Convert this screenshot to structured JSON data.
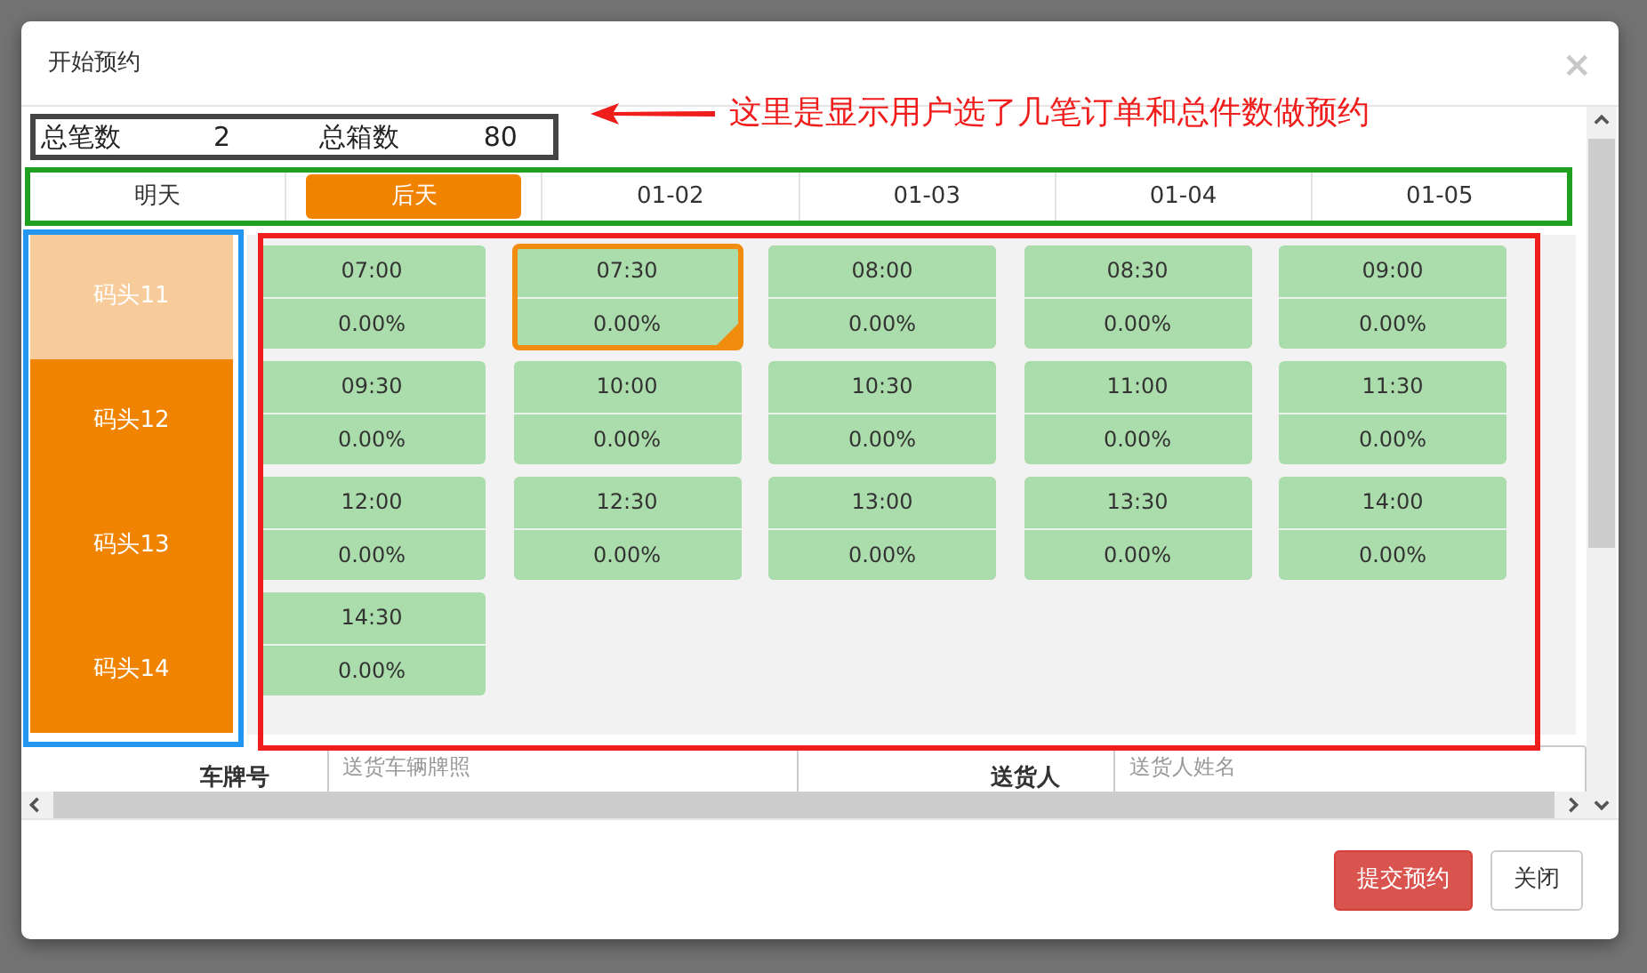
{
  "dialog": {
    "title": "开始预约",
    "close": "×"
  },
  "summary": [
    {
      "label": "总笔数",
      "value": "2"
    },
    {
      "label": "总箱数",
      "value": "80"
    }
  ],
  "annotation": {
    "text": "这里是显示用户选了几笔订单和总件数做预约"
  },
  "day_tabs": [
    {
      "label": "明天",
      "selected": false
    },
    {
      "label": "后天",
      "selected": true
    },
    {
      "label": "01-02",
      "selected": false
    },
    {
      "label": "01-03",
      "selected": false
    },
    {
      "label": "01-04",
      "selected": false
    },
    {
      "label": "01-05",
      "selected": false
    }
  ],
  "docks": [
    {
      "label": "码头11",
      "selected": true
    },
    {
      "label": "码头12",
      "selected": false
    },
    {
      "label": "码头13",
      "selected": false
    },
    {
      "label": "码头14",
      "selected": false
    }
  ],
  "slots": [
    {
      "time": "07:00",
      "usage": "0.00%",
      "selected": false
    },
    {
      "time": "07:30",
      "usage": "0.00%",
      "selected": true
    },
    {
      "time": "08:00",
      "usage": "0.00%",
      "selected": false
    },
    {
      "time": "08:30",
      "usage": "0.00%",
      "selected": false
    },
    {
      "time": "09:00",
      "usage": "0.00%",
      "selected": false
    },
    {
      "time": "09:30",
      "usage": "0.00%",
      "selected": false
    },
    {
      "time": "10:00",
      "usage": "0.00%",
      "selected": false
    },
    {
      "time": "10:30",
      "usage": "0.00%",
      "selected": false
    },
    {
      "time": "11:00",
      "usage": "0.00%",
      "selected": false
    },
    {
      "time": "11:30",
      "usage": "0.00%",
      "selected": false
    },
    {
      "time": "12:00",
      "usage": "0.00%",
      "selected": false
    },
    {
      "time": "12:30",
      "usage": "0.00%",
      "selected": false
    },
    {
      "time": "13:00",
      "usage": "0.00%",
      "selected": false
    },
    {
      "time": "13:30",
      "usage": "0.00%",
      "selected": false
    },
    {
      "time": "14:00",
      "usage": "0.00%",
      "selected": false
    },
    {
      "time": "14:30",
      "usage": "0.00%",
      "selected": false
    }
  ],
  "form_fields": [
    {
      "label": "车牌号",
      "placeholder": "送货车辆牌照"
    },
    {
      "label": "送货人",
      "placeholder": "送货人姓名"
    }
  ],
  "buttons": [
    {
      "label": "提交预约",
      "kind": "danger"
    },
    {
      "label": "关闭",
      "kind": "default"
    }
  ]
}
